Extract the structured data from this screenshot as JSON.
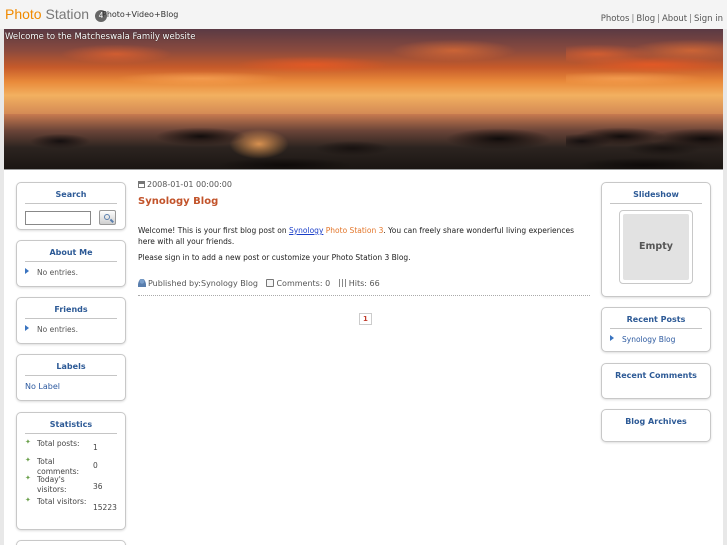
{
  "header": {
    "logo_photo": "Photo",
    "logo_station": "Station",
    "logo_version": "4",
    "tagline": "Photo+Video+Blog",
    "nav": [
      {
        "label": "Photos"
      },
      {
        "label": "Blog"
      },
      {
        "label": "About"
      },
      {
        "label": "Sign in"
      }
    ]
  },
  "banner": {
    "title": "Welcome to the Matcheswala Family website"
  },
  "left_sidebar": {
    "search": {
      "title": "Search",
      "value": "",
      "placeholder": ""
    },
    "about_me": {
      "title": "About Me",
      "entry": "No entries."
    },
    "friends": {
      "title": "Friends",
      "entry": "No entries."
    },
    "labels": {
      "title": "Labels",
      "link": "No Label"
    },
    "statistics": {
      "title": "Statistics",
      "rows": [
        {
          "label": "Total posts:",
          "value": "1"
        },
        {
          "label": "Total comments:",
          "value": "0"
        },
        {
          "label": "Today's visitors:",
          "value": "36"
        },
        {
          "label": "Total visitors:",
          "value": "15223"
        }
      ]
    }
  },
  "post": {
    "date": "2008-01-01 00:00:00",
    "title": "Synology Blog",
    "body_1_prefix": "Welcome! This is your first blog post on ",
    "body_1_link": "Synology",
    "body_1_product": "Photo Station 3",
    "body_1_suffix": ". You can freely share wonderful living experiences here with all your friends.",
    "body_2": "Please sign in to add a new post or customize your Photo Station 3 Blog.",
    "published_by": "Published by:Synology Blog",
    "comments": "Comments: 0",
    "hits": "Hits: 66",
    "page": "1"
  },
  "right_sidebar": {
    "slideshow": {
      "title": "Slideshow",
      "empty": "Empty"
    },
    "recent_posts": {
      "title": "Recent Posts",
      "item": "Synology Blog"
    },
    "recent_comments": {
      "title": "Recent Comments"
    },
    "blog_archives": {
      "title": "Blog Archives"
    }
  },
  "colors": {
    "accent_orange": "#f08a00",
    "widget_title_blue": "#2d5a96",
    "post_title": "#c2532a"
  }
}
